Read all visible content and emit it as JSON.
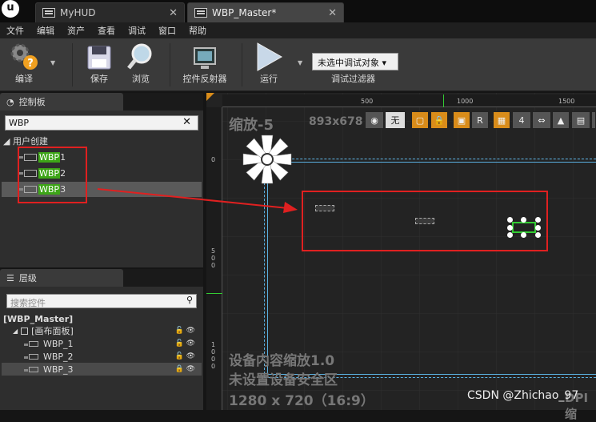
{
  "titlebar": {
    "logo": "u",
    "tabs": [
      {
        "label": "MyHUD",
        "close": "✕"
      },
      {
        "label": "WBP_Master*",
        "close": "✕"
      }
    ]
  },
  "menu": [
    "文件",
    "编辑",
    "资产",
    "查看",
    "调试",
    "窗口",
    "帮助"
  ],
  "toolbar": {
    "compile": "编译",
    "save": "保存",
    "browse": "浏览",
    "reflector": "控件反射器",
    "run": "运行",
    "debug_select": "未选中调试对象",
    "debug_filter": "调试过滤器"
  },
  "palette": {
    "title": "控制板",
    "search_value": "WBP",
    "category": "用户创建",
    "items": [
      {
        "tag": "WBP",
        "suffix": " 1"
      },
      {
        "tag": "WBP",
        "suffix": " 2"
      },
      {
        "tag": "WBP",
        "suffix": " 3"
      }
    ]
  },
  "hierarchy": {
    "title": "层级",
    "search_placeholder": "搜索控件",
    "root": "[WBP_Master]",
    "canvas": "[画布面板]",
    "children": [
      "WBP_1",
      "WBP_2",
      "WBP_3"
    ]
  },
  "designer": {
    "zoom": "缩放-5",
    "resolution": "893x678",
    "ruler_top": [
      "500",
      "1000",
      "1500"
    ],
    "ruler_left_0": "0",
    "ruler_left_500": [
      "5",
      "0",
      "0"
    ],
    "ruler_left_1000": [
      "1",
      "0",
      "0",
      "0"
    ],
    "btn_none": "无",
    "btn_r": "R",
    "btn_4": "4",
    "info_scale": "设备内容缩放1.0",
    "info_safe": "未设置设备安全区",
    "info_size": "1280 x 720（16:9）",
    "dpi": "DPI缩"
  },
  "watermark": "CSDN @Zhichao_97",
  "colors": {
    "accent_green": "#3da517",
    "annotation_red": "#e02020",
    "selection_blue": "#5ab0e0",
    "orange": "#d98c1a"
  }
}
